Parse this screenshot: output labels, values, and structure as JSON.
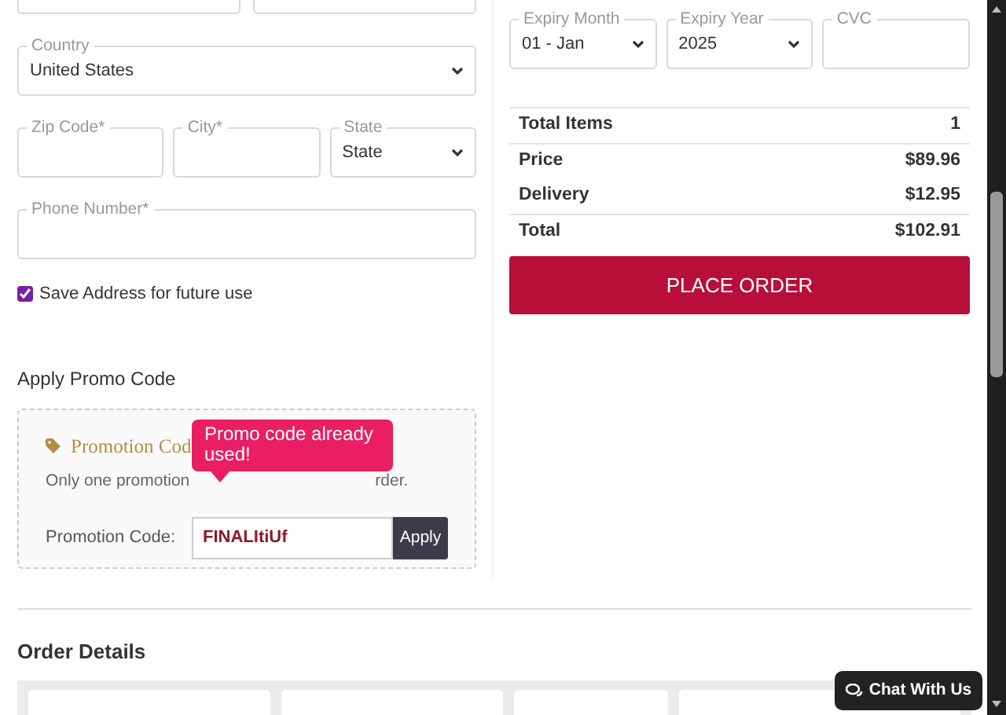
{
  "top_fields": [
    {
      "kind": "text"
    },
    {
      "kind": "text"
    }
  ],
  "country": {
    "label": "Country",
    "value": "United States"
  },
  "address_row": [
    {
      "kind": "text",
      "label": "Zip Code*"
    },
    {
      "kind": "text",
      "label": "City*"
    },
    {
      "kind": "select",
      "label": "State",
      "value": "State"
    }
  ],
  "phone": {
    "label": "Phone Number*"
  },
  "save_address": {
    "label": "Save Address for future use",
    "checked": true
  },
  "promo": {
    "title": "Apply Promo Code",
    "heading": "Promotion Cod",
    "note_start": "Only one promotion",
    "note_end": "rder.",
    "field_label": "Promotion Code:",
    "value": "FINALItiUf",
    "button": "Apply",
    "tooltip": "Promo code already used!"
  },
  "card_row": [
    {
      "kind": "select",
      "label": "Expiry Month",
      "value": "01 - Jan"
    },
    {
      "kind": "select",
      "label": "Expiry Year",
      "value": "2025"
    },
    {
      "kind": "text",
      "label": "CVC"
    }
  ],
  "summary": {
    "groups": [
      [
        {
          "label": "Total Items",
          "value": "1"
        }
      ],
      [
        {
          "label": "Price",
          "value": "$89.96"
        },
        {
          "label": "Delivery",
          "value": "$12.95"
        }
      ],
      [
        {
          "label": "Total",
          "value": "$102.91"
        }
      ]
    ]
  },
  "place_order": "PLACE ORDER",
  "order_details": {
    "title": "Order Details",
    "items": [
      {
        "kind": "card"
      },
      {
        "kind": "card"
      },
      {
        "kind": "card"
      },
      {
        "kind": "card"
      }
    ]
  },
  "chat_button": "Chat With Us"
}
